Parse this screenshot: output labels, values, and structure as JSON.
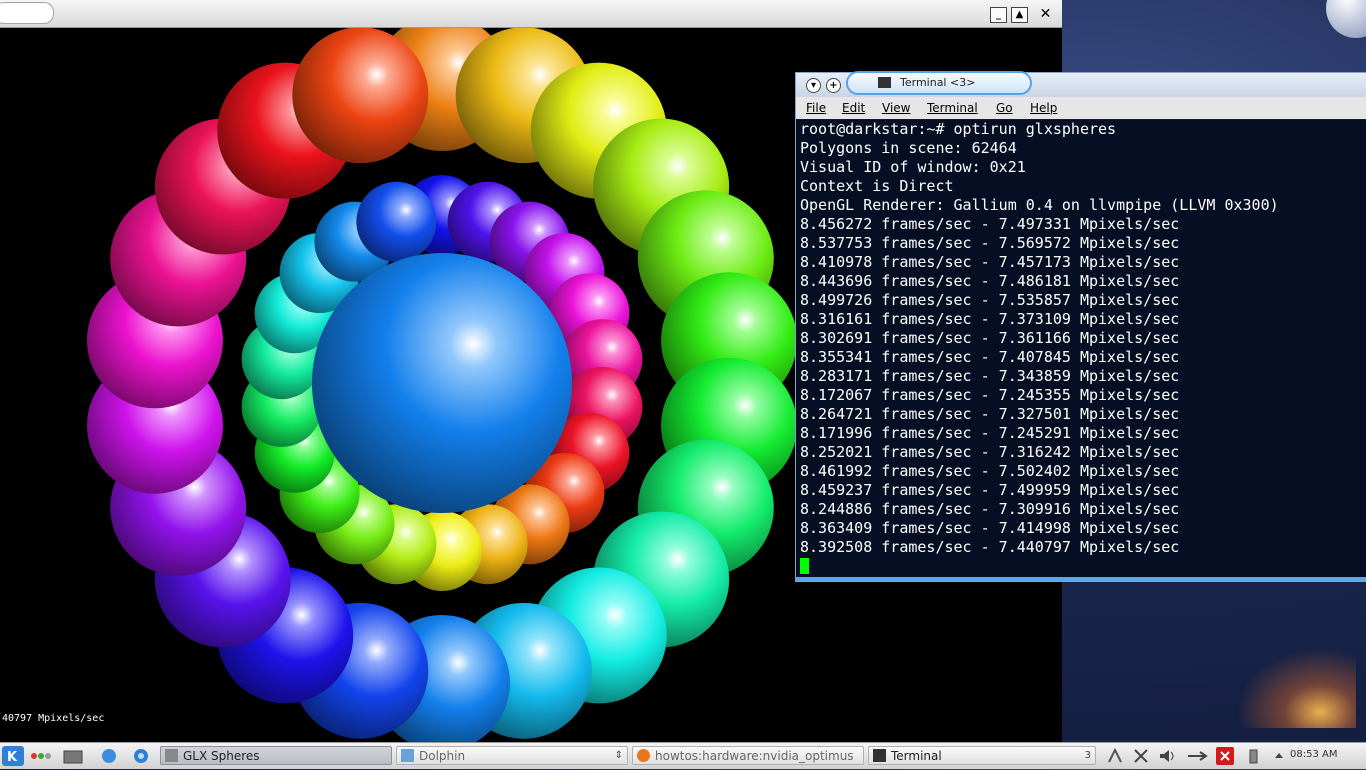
{
  "colors": {
    "terminal_bg": "#0c1830",
    "terminal_text": "#ffffff",
    "cursor": "#00ff00",
    "terminal_accent": "#53a3e6",
    "center_sphere": "#2e7fcf"
  },
  "glx_window": {
    "status_text": "40797 Mpixels/sec"
  },
  "terminal": {
    "title": "Terminal <3>",
    "menu": [
      "File",
      "Edit",
      "View",
      "Terminal",
      "Go",
      "Help"
    ],
    "lines": [
      "root@darkstar:~# optirun glxspheres",
      "Polygons in scene: 62464",
      "Visual ID of window: 0x21",
      "Context is Direct",
      "OpenGL Renderer: Gallium 0.4 on llvmpipe (LLVM 0x300)",
      "8.456272 frames/sec - 7.497331 Mpixels/sec",
      "8.537753 frames/sec - 7.569572 Mpixels/sec",
      "8.410978 frames/sec - 7.457173 Mpixels/sec",
      "8.443696 frames/sec - 7.486181 Mpixels/sec",
      "8.499726 frames/sec - 7.535857 Mpixels/sec",
      "8.316161 frames/sec - 7.373109 Mpixels/sec",
      "8.302691 frames/sec - 7.361166 Mpixels/sec",
      "8.355341 frames/sec - 7.407845 Mpixels/sec",
      "8.283171 frames/sec - 7.343859 Mpixels/sec",
      "8.172067 frames/sec - 7.245355 Mpixels/sec",
      "8.264721 frames/sec - 7.327501 Mpixels/sec",
      "8.171996 frames/sec - 7.245291 Mpixels/sec",
      "8.252021 frames/sec - 7.316242 Mpixels/sec",
      "8.461992 frames/sec - 7.502402 Mpixels/sec",
      "8.459237 frames/sec - 7.499959 Mpixels/sec",
      "8.244886 frames/sec - 7.309916 Mpixels/sec",
      "8.363409 frames/sec - 7.414998 Mpixels/sec",
      "8.392508 frames/sec - 7.440797 Mpixels/sec"
    ]
  },
  "taskbar": {
    "tasks": [
      {
        "label": "GLX Spheres",
        "icon": "glx-app-icon"
      },
      {
        "label": "Dolphin",
        "icon": "folder-icon"
      },
      {
        "label": "howtos:hardware:nvidia_optimus",
        "icon": "firefox-icon"
      },
      {
        "label": "Terminal",
        "icon": "terminal-icon",
        "count": "3"
      }
    ],
    "clock": "08:53 AM"
  }
}
